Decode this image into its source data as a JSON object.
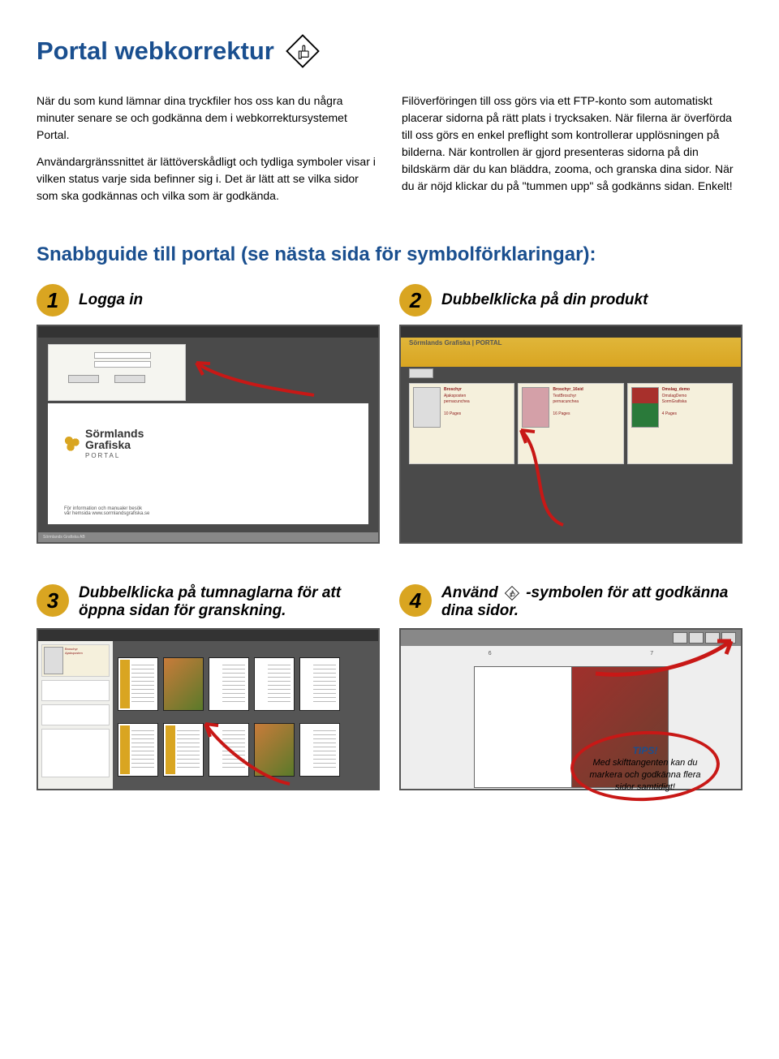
{
  "header": {
    "title": "Portal webkorrektur"
  },
  "intro": {
    "left_p1": "När du som kund lämnar dina tryckfiler hos oss kan du några minuter senare se och godkänna dem i webkorrektursystemet Portal.",
    "left_p2": "Användargränssnittet är lättöverskådligt och tydliga symboler visar i vilken status varje sida befinner sig i. Det är lätt att se vilka sidor som ska godkännas och vilka som är godkända.",
    "right_p1": "Filöverföringen till oss görs via ett FTP-konto som automatiskt placerar sidorna på rätt plats i trycksaken. När filerna är överförda till oss görs en enkel preflight som kontrollerar upplösningen på bilderna. När kontrollen är gjord presenteras sidorna på din bildskärm där du kan bläddra, zooma, och granska dina sidor. När du är nöjd klickar du på \"tummen upp\" så godkänns sidan. Enkelt!",
    "enkelt": "Enkelt!"
  },
  "section_title": "Snabbguide till portal (se nästa sida för symbolförklaringar):",
  "steps": {
    "s1": {
      "num": "1",
      "title": "Logga in"
    },
    "s2": {
      "num": "2",
      "title": "Dubbelklicka på din produkt"
    },
    "s3": {
      "num": "3",
      "title": "Dubbelklicka på tumnaglarna för att öppna sidan för granskning."
    },
    "s4": {
      "num": "4",
      "title_before": "Använd ",
      "title_after": "-symbolen för att godkänna dina sidor."
    }
  },
  "ss1": {
    "logo_line1": "Sörmlands",
    "logo_line2": "Grafiska",
    "logo_sub": "PORTAL",
    "footer1": "För information och manualer besök",
    "footer2": "vår hemsida www.sormlandsgrafiska.se",
    "company": "Sörmlands Grafiska AB"
  },
  "ss2": {
    "header_brand": "Sörmlands Grafiska | PORTAL",
    "cards": [
      {
        "title": "Broschyr",
        "l1": "Ajaksposten",
        "l2": "pernacunchea",
        "pages": "10 Pages"
      },
      {
        "title": "Broschyr_16sid",
        "l1": "TestBroschyr",
        "l2": "pernacunchea",
        "pages": "16 Pages"
      },
      {
        "title": "Omslag_demo",
        "l1": "OmslagDemo",
        "l2": "SormGrafiska",
        "pages": "4 Pages"
      }
    ]
  },
  "tips": {
    "title": "TIPS!",
    "body": "Med skifttangenten kan du markera och godkänna flera sidor samtidigt!"
  }
}
